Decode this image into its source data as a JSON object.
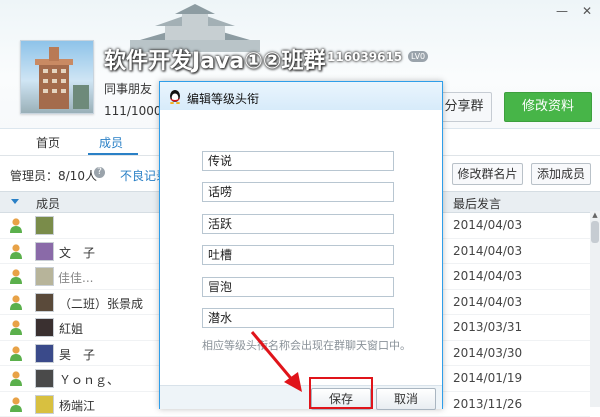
{
  "window": {
    "close_glyph": "✕",
    "minimize_glyph": "—"
  },
  "group": {
    "name": "软件开发Java①②班群",
    "id": "116039615",
    "level": "LV0",
    "category": "同事朋友",
    "members": "111/1000人"
  },
  "header_buttons": {
    "share": "分享群",
    "edit": "修改资料"
  },
  "tabs": {
    "home": "首页",
    "members": "成员"
  },
  "toolbar": {
    "admins": "管理员：8/10人",
    "help": "?",
    "bad_records": "不良记录",
    "edit_card": "修改群名片",
    "add_member": "添加成员"
  },
  "table": {
    "col_member": "成员",
    "col_last": "最后发言",
    "rows": [
      {
        "name": "",
        "date": "2014/04/03",
        "avatar": "#7a8c4a"
      },
      {
        "name": "文　子",
        "date": "2014/04/03",
        "avatar": "#8a6aa8"
      },
      {
        "name": "佳佳...",
        "date": "2014/04/03",
        "avatar": "#b7b49a",
        "muted": true
      },
      {
        "name": "（二班）张景成",
        "date": "2014/04/03",
        "avatar": "#5a4a3a"
      },
      {
        "name": "紅姐",
        "date": "2013/03/31",
        "avatar": "#3a3030"
      },
      {
        "name": "昊　子",
        "date": "2014/03/30",
        "avatar": "#3a4a8a"
      },
      {
        "name": "Ｙｏｎｇ、",
        "date": "2014/01/19",
        "avatar": "#4a4a4a"
      },
      {
        "name": "杨端江",
        "date": "2013/11/26",
        "avatar": "#d8c040"
      }
    ]
  },
  "dialog": {
    "title": "编辑等级头衔",
    "titles": [
      "传说",
      "话唠",
      "活跃",
      "吐槽",
      "冒泡",
      "潜水"
    ],
    "hint": "相应等级头衔名称会出现在群聊天窗口中。",
    "save": "保存",
    "cancel": "取消"
  },
  "colors": {
    "accent": "#2a80c6",
    "primary_button": "#47b548",
    "highlight": "#e0141a"
  }
}
